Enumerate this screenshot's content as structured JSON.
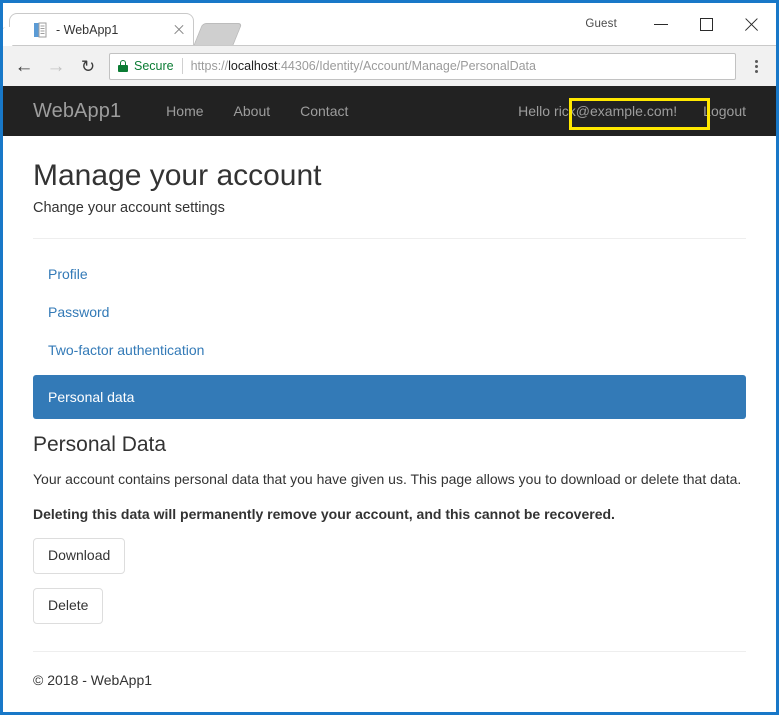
{
  "browser": {
    "tab": {
      "title": "- WebApp1",
      "favicon_icon": "page-icon",
      "close_icon": "close-icon"
    },
    "new_tab_icon": "new-tab-icon",
    "guest_label": "Guest",
    "window_controls": {
      "minimize_icon": "minimize-icon",
      "maximize_icon": "maximize-icon",
      "close_icon": "close-icon"
    },
    "toolbar": {
      "back_icon": "back-arrow-icon",
      "forward_icon": "forward-arrow-icon",
      "reload_icon": "reload-icon",
      "lock_icon": "lock-icon",
      "security_label": "Secure",
      "url_scheme": "https://",
      "url_host": "localhost",
      "url_rest": ":44306/Identity/Account/Manage/PersonalData",
      "url_full": "https://localhost:44306/Identity/Account/Manage/PersonalData",
      "menu_icon": "three-dots-menu-icon"
    }
  },
  "navbar": {
    "brand": "WebApp1",
    "links": [
      {
        "label": "Home"
      },
      {
        "label": "About"
      },
      {
        "label": "Contact"
      }
    ],
    "hello_prefix": "Hello",
    "user_email": "rick@example.com!",
    "logout_label": "Logout",
    "highlight_color": "#ffe800",
    "background_color": "#222222"
  },
  "page": {
    "title": "Manage your account",
    "subtitle": "Change your account settings",
    "side_nav": [
      {
        "label": "Profile",
        "active": false
      },
      {
        "label": "Password",
        "active": false
      },
      {
        "label": "Two-factor authentication",
        "active": false
      },
      {
        "label": "Personal data",
        "active": true
      }
    ],
    "section_title": "Personal Data",
    "paragraph": "Your account contains personal data that you have given us. This page allows you to download or delete that data.",
    "warning": "Deleting this data will permanently remove your account, and this cannot be recovered.",
    "download_button": "Download",
    "delete_button": "Delete",
    "footer": "© 2018 - WebApp1",
    "accent_color": "#337ab7"
  }
}
